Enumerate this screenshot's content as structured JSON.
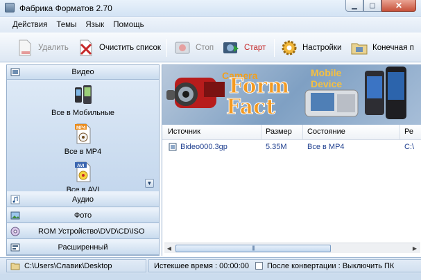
{
  "window": {
    "title": "Фабрика Форматов 2.70"
  },
  "menu": [
    "Действия",
    "Темы",
    "Язык",
    "Помощь"
  ],
  "toolbar": {
    "delete": "Удалить",
    "clear": "Очистить список",
    "stop": "Стоп",
    "start": "Старт",
    "settings": "Настройки",
    "output": "Конечная п"
  },
  "categories": {
    "video": "Видео",
    "audio": "Аудио",
    "photo": "Фото",
    "rom": "ROM Устройство\\DVD\\CD\\ISO",
    "advanced": "Расширенный"
  },
  "video_formats": [
    "Все в Мобильные",
    "Все в MP4",
    "Все в AVI"
  ],
  "format_badges": {
    "mp4": "MP4",
    "avi": "AVI"
  },
  "banner": {
    "camera_label": "Camera",
    "mobile_label": "Mobile",
    "device_label": "Device",
    "word1": "Form",
    "word2": "Fact"
  },
  "table": {
    "columns": [
      "Источник",
      "Размер",
      "Состояние",
      "Ре"
    ],
    "rows": [
      {
        "source": "Bideo000.3gp",
        "size": "5.35M",
        "status": "Все в MP4",
        "result": "C:\\"
      }
    ]
  },
  "status": {
    "path": "C:\\Users\\Славик\\Desktop",
    "elapsed": "Истекшее время : 00:00:00",
    "after": "После конвертации : Выключить ПК"
  },
  "colors": {
    "accent_red": "#c62828",
    "panel_blue": "#c9dbee",
    "link_blue": "#1f3f8f"
  }
}
